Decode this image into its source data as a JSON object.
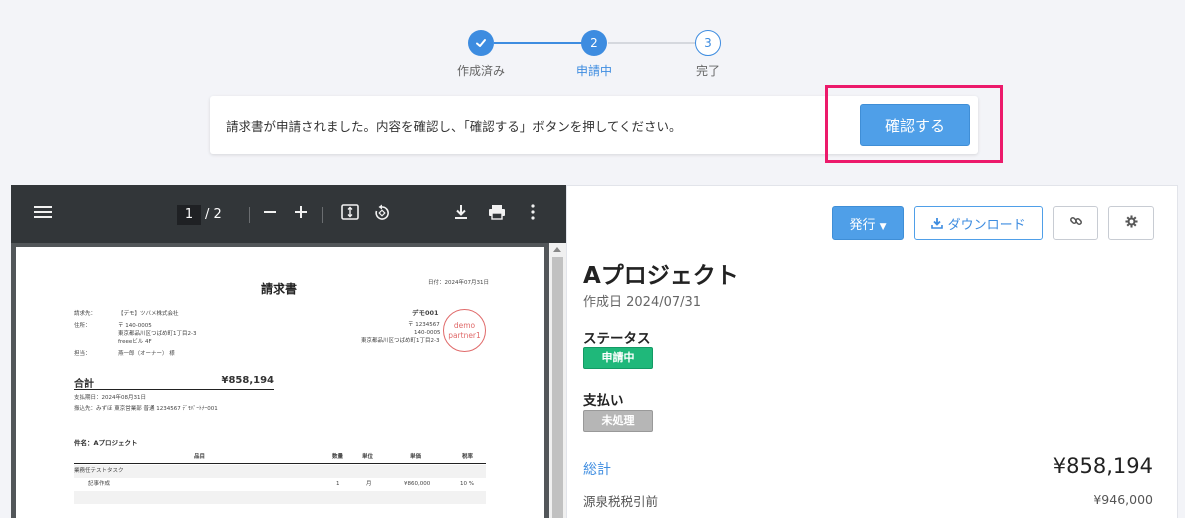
{
  "stepper": {
    "steps": [
      {
        "label": "作成済み",
        "number": ""
      },
      {
        "label": "申請中",
        "number": "2"
      },
      {
        "label": "完了",
        "number": "3"
      }
    ],
    "done_icon": "check-icon"
  },
  "notice": {
    "message": "請求書が申請されました。内容を確認し、「確認する」ボタンを押してください。",
    "confirm_label": "確認する"
  },
  "pdf": {
    "current_page": "1",
    "page_sep": "/",
    "total_pages": "2",
    "icons": [
      "menu-icon",
      "zoom-out-icon",
      "zoom-in-icon",
      "fit-page-icon",
      "rotate-icon",
      "download-icon",
      "print-icon",
      "more-icon"
    ],
    "document": {
      "title": "請求書",
      "date": "日付：2024年07月31日",
      "to_label": "請求先：",
      "to_value": "【デモ】ツバメ株式会社",
      "address_label": "住所：",
      "address_zip": "〒 140-0005",
      "address_line1": "東京都品川区つばめ町1丁目2-3",
      "address_line2": "freeeビル 4F",
      "attn_label": "担当：",
      "attn_value": "燕一郎（オーナー） 様",
      "company": "デモ001",
      "company_zip": "〒 1234567",
      "company_zip2": "140-0005",
      "company_address": "東京都品川区つばめ町1丁目2-3",
      "stamp_line1": "demo",
      "stamp_line2": "partner1",
      "total_label": "合計",
      "total_amount": "¥858,194",
      "due": "支払期日：2024年08月31日",
      "bank": "振込先：みずほ 東京営業部 普通 1234567 ﾃﾞﾓﾊﾟｰﾄﾅｰ001",
      "project": "件名：Aプロジェクト",
      "columns": [
        "品目",
        "数量",
        "単位",
        "単価",
        "税率"
      ],
      "row_group": "業務任テストタスク",
      "row_item": {
        "name": "記事作成",
        "qty": "1",
        "unit": "月",
        "price": "¥860,000",
        "tax": "10 %"
      }
    }
  },
  "panel": {
    "issue_label": "発行",
    "download_label": "ダウンロード",
    "project_title": "Aプロジェクト",
    "created": "作成日 2024/07/31",
    "status_label": "ステータス",
    "status_value": "申請中",
    "payment_label": "支払い",
    "payment_value": "未処理",
    "total_label": "総計",
    "total_value": "¥858,194",
    "pre_tax_label": "源泉税税引前",
    "pre_tax_value": "¥946,000"
  },
  "colors": {
    "accent": "#3d8ce0",
    "highlight": "#ec1a6b",
    "badge_applying": "#1fb87a",
    "badge_unpaid": "#b6b6b6"
  }
}
